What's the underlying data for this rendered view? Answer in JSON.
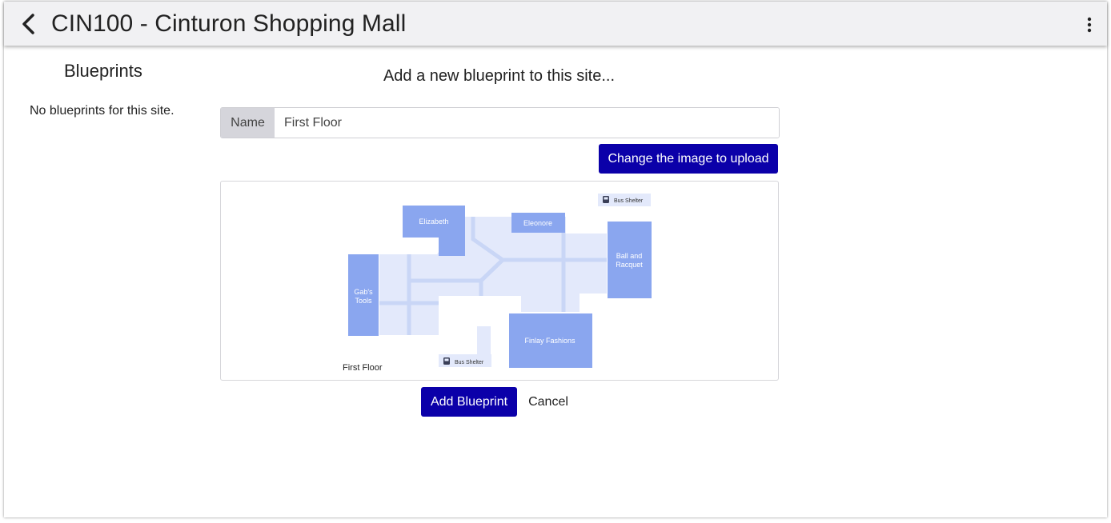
{
  "header": {
    "title": "CIN100 - Cinturon Shopping Mall"
  },
  "sidebar": {
    "title": "Blueprints",
    "empty_message": "No blueprints for this site."
  },
  "form": {
    "title": "Add a new blueprint to this site...",
    "name_label": "Name",
    "name_value": "First Floor",
    "upload_button": "Change the image to upload",
    "submit_button": "Add Blueprint",
    "cancel_button": "Cancel"
  },
  "floorplan": {
    "caption": "First Floor",
    "stores": {
      "elizabeth": "Elizabeth",
      "eleonore": "Eleonore",
      "ball_racquet_1": "Ball and",
      "ball_racquet_2": "Racquet",
      "gabs_tools_1": "Gab's",
      "gabs_tools_2": "Tools",
      "finlay": "Finlay Fashions"
    },
    "bus_shelter_top": "Bus Shelter",
    "bus_shelter_bottom": "Bus Shelter",
    "colors": {
      "store": "#8aa6ef",
      "corridor": "#e3e9fb",
      "path": "#c9d6f6",
      "primary": "#0b00a9"
    }
  }
}
